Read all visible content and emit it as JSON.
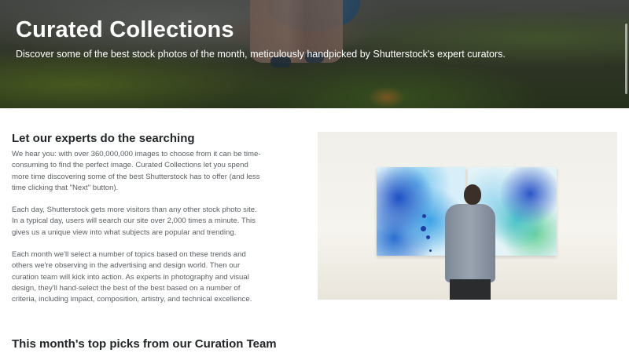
{
  "hero": {
    "title": "Curated Collections",
    "subtitle": "Discover some of the best stock photos of the month, meticulously handpicked by Shutterstock's expert curators."
  },
  "intro": {
    "heading": "Let our experts do the searching",
    "paragraphs": [
      "We hear you: with over 360,000,000 images to choose from it can be time-consuming to find the perfect image. Curated Collections let you spend more time discovering some of the best Shutterstock has to offer (and less time clicking that \"Next\" button).",
      "Each day, Shutterstock gets more visitors than any other stock photo site. In a typical day, users will search our site over 2,000 times a minute. This gives us a unique view into what subjects are popular and trending.",
      "Each month we'll select a number of topics based on these trends and others we're observing in the advertising and design world. Then our curation team will kick into action. As experts in photography and visual design, they'll hand-select the best of the best based on a number of criteria, including impact, composition, artistry, and technical excellence."
    ]
  },
  "top_picks": {
    "heading": "This month's top picks from our Curation Team"
  },
  "colors": {
    "heading_text": "#222628",
    "body_text": "#5a5e62",
    "hero_text": "#ffffff"
  }
}
